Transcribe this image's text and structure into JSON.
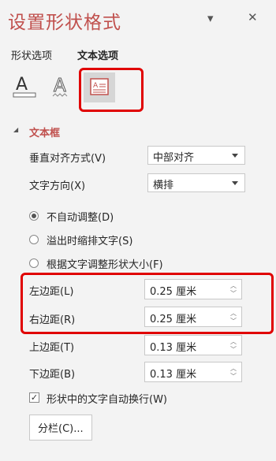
{
  "header": {
    "title": "设置形状格式",
    "collapse_label": "▾",
    "close_label": "✕"
  },
  "tabs": [
    {
      "label": "形状选项",
      "active": false
    },
    {
      "label": "文本选项",
      "active": true
    }
  ],
  "icons": {
    "text_fill": "text-fill-icon",
    "text_outline": "text-outline-icon",
    "textbox": "textbox-icon"
  },
  "section": {
    "title": "文本框",
    "arrow": "◢"
  },
  "vertical_align": {
    "label": "垂直对齐方式(V)",
    "value": "中部对齐"
  },
  "text_direction": {
    "label": "文字方向(X)",
    "value": "横排"
  },
  "autofit": {
    "options": [
      {
        "label": "不自动调整(D)",
        "checked": true
      },
      {
        "label": "溢出时缩排文字(S)",
        "checked": false
      },
      {
        "label": "根据文字调整形状大小(F)",
        "checked": false
      }
    ]
  },
  "margins": {
    "left": {
      "label": "左边距(L)",
      "value": "0.25 厘米"
    },
    "right": {
      "label": "右边距(R)",
      "value": "0.25 厘米"
    },
    "top": {
      "label": "上边距(T)",
      "value": "0.13 厘米"
    },
    "bottom": {
      "label": "下边距(B)",
      "value": "0.13 厘米"
    }
  },
  "wrap": {
    "label": "形状中的文字自动换行(W)",
    "checked": true,
    "mark": "✓"
  },
  "columns_button": {
    "label": "分栏(C)..."
  },
  "colors": {
    "accent": "#c0504d",
    "highlight": "#e00000"
  }
}
